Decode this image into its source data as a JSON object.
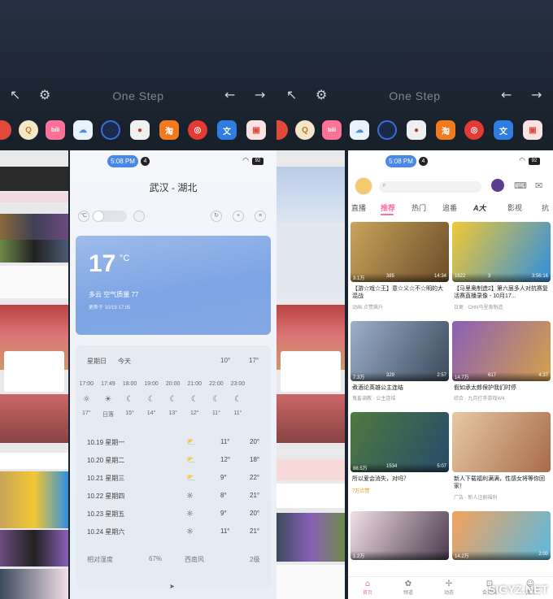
{
  "desktop": {
    "one_step_label": "One Step",
    "icons": [
      "back-arrow-icon",
      "gear-icon",
      "left-arrow-icon",
      "right-arrow-icon"
    ],
    "dock_apps": [
      "red-app",
      "q-app",
      "bilibili",
      "weather-app",
      "camera-app",
      "music-app",
      "taobao",
      "netease-music",
      "translate",
      "wallet-app"
    ]
  },
  "weather": {
    "time": "5:08 PM",
    "notif_count": "4",
    "battery": "92",
    "city": "武汉 - 湖北",
    "unit": "°C",
    "temperature": "17",
    "degree_sign": "°C",
    "condition": "多云    空气质量 77",
    "updated": "更新于 10/19 17:05",
    "today_label": "星期日",
    "today_word": "今天",
    "today_low": "10°",
    "today_high": "17°",
    "hours": [
      "17:00",
      "17:49",
      "18:00",
      "19:00",
      "20:00",
      "21:00",
      "22:00",
      "23:00"
    ],
    "hour_temps": [
      "17°",
      "日落",
      "15°",
      "14°",
      "13°",
      "12°",
      "11°",
      "11°"
    ],
    "days": [
      {
        "date": "10.19 星期一",
        "low": "11°",
        "high": "20°"
      },
      {
        "date": "10.20 星期二",
        "low": "12°",
        "high": "18°"
      },
      {
        "date": "10.21 星期三",
        "low": "9°",
        "high": "22°"
      },
      {
        "date": "10.22 星期四",
        "low": "8°",
        "high": "21°"
      },
      {
        "date": "10.23 星期五",
        "low": "9°",
        "high": "20°"
      },
      {
        "date": "10.24 星期六",
        "low": "11°",
        "high": "21°"
      }
    ],
    "humidity_label": "相对湿度",
    "humidity_value": "67%",
    "wind_label": "西南风",
    "wind_value": "2级"
  },
  "bili": {
    "time": "5:08 PM",
    "notif_count": "4",
    "battery": "92",
    "tabs": [
      "直播",
      "推荐",
      "热门",
      "追番",
      "影视",
      "抗"
    ],
    "videos": [
      {
        "views": "3.1万",
        "comments": "385",
        "duration": "14:34",
        "title": "【游☆戏☆王】意☆义☆不☆明的大混战",
        "tag": "动画·点赞飙升",
        "color1": "#c9a45a",
        "color2": "#6b4d2a"
      },
      {
        "views": "1622",
        "comments": "3",
        "duration": "3:56:16",
        "title": "【马里奥制造2】第六届多人对抗赛复活赛直播录像 - 10月17...",
        "tag": "日更 · CHN马里奥制造",
        "color1": "#f2c833",
        "color2": "#2f8fe0"
      },
      {
        "views": "7.3万",
        "comments": "329",
        "duration": "2:57",
        "title": "煮酒论英雄公主连结",
        "tag": "鬼畜调教 · 公主连结",
        "color1": "#9bb0c9",
        "color2": "#3b4a5c"
      },
      {
        "views": "14.7万",
        "comments": "617",
        "duration": "4:37",
        "title": "假如承太郎保护我们时停",
        "tag": "综合 · 九月打手游戏W4",
        "color1": "#8a5fb8",
        "color2": "#d6a04a"
      },
      {
        "views": "88.5万",
        "comments": "1534",
        "duration": "5:07",
        "title": "所以爱会消失，对吗？",
        "tag": "7万点赞",
        "color1": "#4d7a3f",
        "color2": "#274a6b"
      },
      {
        "views": "",
        "comments": "",
        "duration": "",
        "title": "新人下载福利满满，性感女将等你回家！",
        "tag": "广告 · 新人注册福利",
        "color1": "#e7c9a3",
        "color2": "#a86b4a"
      },
      {
        "views": "1.2万",
        "comments": "",
        "duration": "",
        "title": "",
        "tag": "",
        "color1": "#f2dfe6",
        "color2": "#4a3a4d"
      },
      {
        "views": "14.2万",
        "comments": "",
        "duration": "2:00",
        "title": "",
        "tag": "",
        "color1": "#f5a25a",
        "color2": "#5ab9e0"
      }
    ],
    "nav": [
      "首页",
      "频道",
      "动态",
      "会员购",
      "我的"
    ],
    "watermark": "SIGYZ.NET"
  }
}
